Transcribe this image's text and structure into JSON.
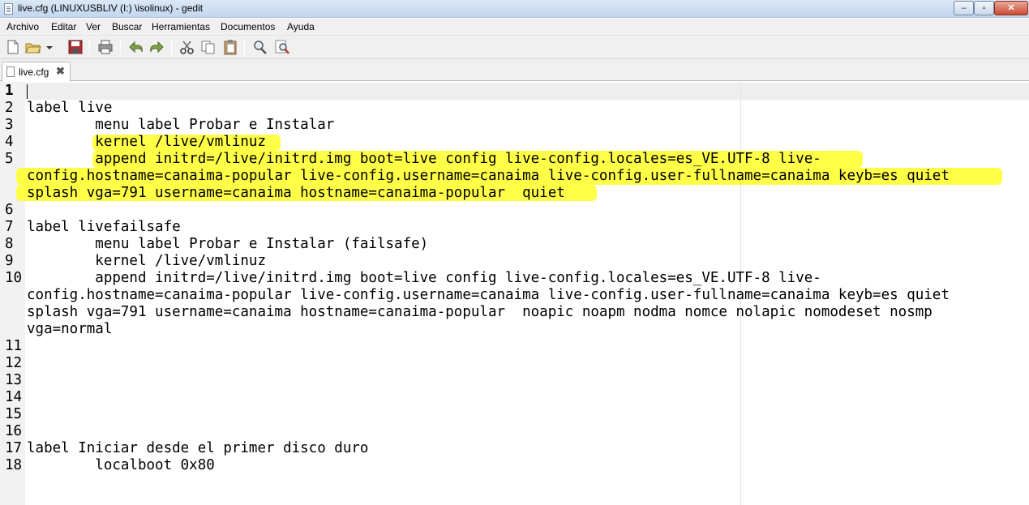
{
  "window": {
    "title": "live.cfg (LINUXUSBLIV (I:) \\isolinux) - gedit",
    "controls": {
      "minimize": "‒",
      "maximize": "▫",
      "close": "✕"
    }
  },
  "menu": {
    "items": [
      "Archivo",
      "Editar",
      "Ver",
      "Buscar",
      "Herramientas",
      "Documentos",
      "Ayuda"
    ]
  },
  "toolbar": {
    "icons": [
      "new-document-icon",
      "open-icon",
      "open-dropdown-icon",
      "save-icon",
      "print-icon",
      "undo-icon",
      "redo-icon",
      "cut-icon",
      "copy-icon",
      "paste-icon",
      "find-icon",
      "find-replace-icon"
    ]
  },
  "tabs": [
    {
      "label": "live.cfg",
      "close": "✖"
    }
  ],
  "editor": {
    "highlight_color": "#ffff33",
    "rows": [
      {
        "num": "1",
        "text": ""
      },
      {
        "num": "2",
        "text": "label live"
      },
      {
        "num": "3",
        "text": "        menu label Probar e Instalar"
      },
      {
        "num": "4",
        "text": "        kernel /live/vmlinuz"
      },
      {
        "num": "5",
        "text": "        append initrd=/live/initrd.img boot=live config live-config.locales=es_VE.UTF-8 live-"
      },
      {
        "num": "",
        "text": "config.hostname=canaima-popular live-config.username=canaima live-config.user-fullname=canaima keyb=es quiet"
      },
      {
        "num": "",
        "text": "splash vga=791 username=canaima hostname=canaima-popular  quiet"
      },
      {
        "num": "6",
        "text": ""
      },
      {
        "num": "7",
        "text": "label livefailsafe"
      },
      {
        "num": "8",
        "text": "        menu label Probar e Instalar (failsafe)"
      },
      {
        "num": "9",
        "text": "        kernel /live/vmlinuz"
      },
      {
        "num": "10",
        "text": "        append initrd=/live/initrd.img boot=live config live-config.locales=es_VE.UTF-8 live-"
      },
      {
        "num": "",
        "text": "config.hostname=canaima-popular live-config.username=canaima live-config.user-fullname=canaima keyb=es quiet"
      },
      {
        "num": "",
        "text": "splash vga=791 username=canaima hostname=canaima-popular  noapic noapm nodma nomce nolapic nomodeset nosmp"
      },
      {
        "num": "",
        "text": "vga=normal"
      },
      {
        "num": "11",
        "text": ""
      },
      {
        "num": "12",
        "text": ""
      },
      {
        "num": "13",
        "text": ""
      },
      {
        "num": "14",
        "text": ""
      },
      {
        "num": "15",
        "text": ""
      },
      {
        "num": "16",
        "text": ""
      },
      {
        "num": "17",
        "text": "label Iniciar desde el primer disco duro"
      },
      {
        "num": "18",
        "text": "        localboot 0x80"
      }
    ]
  }
}
